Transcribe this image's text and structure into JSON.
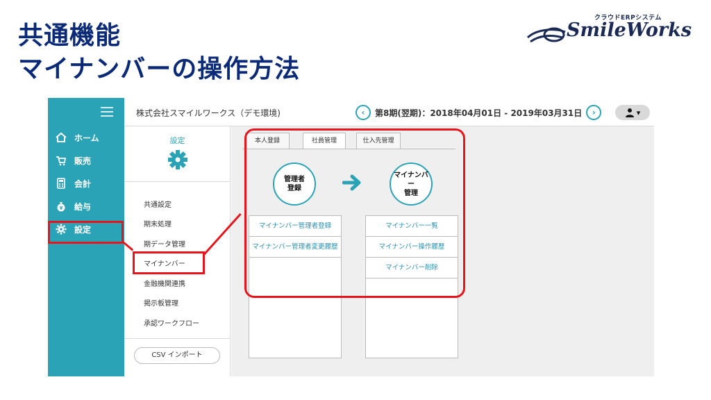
{
  "slide": {
    "title_line1": "共通機能",
    "title_line2": "マイナンバーの操作方法",
    "logo_sub": "クラウドERPシステム",
    "logo_main": "SmileWorks"
  },
  "sidebar": {
    "items": [
      {
        "label": "ホーム",
        "icon": "home-icon"
      },
      {
        "label": "販売",
        "icon": "cart-icon"
      },
      {
        "label": "会計",
        "icon": "calculator-icon"
      },
      {
        "label": "給与",
        "icon": "money-bag-icon"
      },
      {
        "label": "設定",
        "icon": "gear-icon"
      }
    ]
  },
  "topbar": {
    "company": "株式会社スマイルワークス（デモ環境)",
    "period": "第8期(翌期)：2018年04月01日 - 2019年03月31日",
    "prev": "‹",
    "next": "›",
    "user_caret": "▾"
  },
  "panel": {
    "title": "設定",
    "menu": [
      "共通設定",
      "期末処理",
      "期データ管理",
      "マイナンバー",
      "金融機関連携",
      "掲示板管理",
      "承認ワークフロー"
    ],
    "csv_button": "CSV インポート"
  },
  "content": {
    "tabs": [
      "本人登録",
      "社員管理",
      "仕入先管理"
    ],
    "active_tab": 1,
    "circle_left_l1": "管理者",
    "circle_left_l2": "登録",
    "circle_right_l1": "マイナンバー",
    "circle_right_l2": "管理",
    "left_links": [
      "マイナンバー管理者登録",
      "マイナンバー管理者変更履歴"
    ],
    "right_links": [
      "マイナンバー一覧",
      "マイナンバー操作履歴",
      "マイナンバー削除"
    ]
  },
  "colors": {
    "accent": "#2ba3b7",
    "title": "#0a2a78",
    "highlight": "#e8141c"
  }
}
